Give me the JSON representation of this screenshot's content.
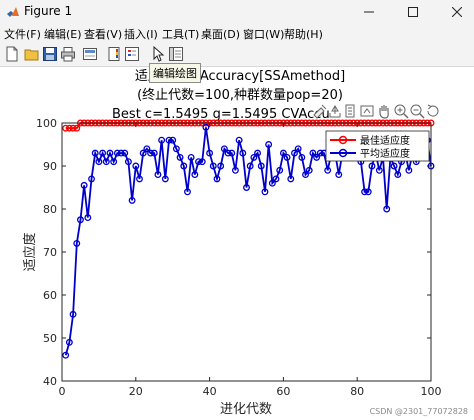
{
  "window": {
    "title": "Figure 1"
  },
  "menu": [
    "文件(F)",
    "编辑(E)",
    "查看(V)",
    "插入(I)",
    "工具(T)",
    "桌面(D)",
    "窗口(W)",
    "帮助(H)"
  ],
  "toolbar": {
    "tooltip": "编辑绘图"
  },
  "watermark": "CSDN @2301_77072828",
  "chart_data": {
    "type": "line",
    "title_lines": [
      "适应度曲线Accuracy[SSAmethod]",
      "(终止代数=100,种群数量pop=20)",
      "Best c=1.5495 g=1.5495 CVAccu"
    ],
    "xlabel": "进化代数",
    "ylabel": "适应度",
    "xlim": [
      0,
      100
    ],
    "ylim": [
      40,
      100
    ],
    "xticks": [
      0,
      20,
      40,
      60,
      80,
      100
    ],
    "yticks": [
      40,
      50,
      60,
      70,
      80,
      90,
      100
    ],
    "legend_position": "top-right",
    "grid": false,
    "series": [
      {
        "name": "最佳适应度",
        "color": "#ff0000",
        "marker": "circle",
        "x": [
          1,
          2,
          3,
          4,
          5,
          6,
          7,
          8,
          9,
          10,
          11,
          12,
          13,
          14,
          15,
          16,
          17,
          18,
          19,
          20,
          21,
          22,
          23,
          24,
          25,
          26,
          27,
          28,
          29,
          30,
          31,
          32,
          33,
          34,
          35,
          36,
          37,
          38,
          39,
          40,
          41,
          42,
          43,
          44,
          45,
          46,
          47,
          48,
          49,
          50,
          51,
          52,
          53,
          54,
          55,
          56,
          57,
          58,
          59,
          60,
          61,
          62,
          63,
          64,
          65,
          66,
          67,
          68,
          69,
          70,
          71,
          72,
          73,
          74,
          75,
          76,
          77,
          78,
          79,
          80,
          81,
          82,
          83,
          84,
          85,
          86,
          87,
          88,
          89,
          90,
          91,
          92,
          93,
          94,
          95,
          96,
          97,
          98,
          99,
          100
        ],
        "values": [
          98.8,
          98.8,
          98.8,
          98.8,
          100,
          100,
          100,
          100,
          100,
          100,
          100,
          100,
          100,
          100,
          100,
          100,
          100,
          100,
          100,
          100,
          100,
          100,
          100,
          100,
          100,
          100,
          100,
          100,
          100,
          100,
          100,
          100,
          100,
          100,
          100,
          100,
          100,
          100,
          100,
          100,
          100,
          100,
          100,
          100,
          100,
          100,
          100,
          100,
          100,
          100,
          100,
          100,
          100,
          100,
          100,
          100,
          100,
          100,
          100,
          100,
          100,
          100,
          100,
          100,
          100,
          100,
          100,
          100,
          100,
          100,
          100,
          100,
          100,
          100,
          100,
          100,
          100,
          100,
          100,
          100,
          100,
          100,
          100,
          100,
          100,
          100,
          100,
          100,
          100,
          100,
          100,
          100,
          100,
          100,
          100,
          100,
          100,
          100,
          100,
          100
        ]
      },
      {
        "name": "平均适应度",
        "color": "#0000cc",
        "marker": "circle",
        "x": [
          1,
          2,
          3,
          4,
          5,
          6,
          7,
          8,
          9,
          10,
          11,
          12,
          13,
          14,
          15,
          16,
          17,
          18,
          19,
          20,
          21,
          22,
          23,
          24,
          25,
          26,
          27,
          28,
          29,
          30,
          31,
          32,
          33,
          34,
          35,
          36,
          37,
          38,
          39,
          40,
          41,
          42,
          43,
          44,
          45,
          46,
          47,
          48,
          49,
          50,
          51,
          52,
          53,
          54,
          55,
          56,
          57,
          58,
          59,
          60,
          61,
          62,
          63,
          64,
          65,
          66,
          67,
          68,
          69,
          70,
          71,
          72,
          73,
          74,
          75,
          76,
          77,
          78,
          79,
          80,
          81,
          82,
          83,
          84,
          85,
          86,
          87,
          88,
          89,
          90,
          91,
          92,
          93,
          94,
          95,
          96,
          97,
          98,
          99,
          100
        ],
        "values": [
          46,
          49,
          55.5,
          72,
          77.5,
          85.5,
          78,
          87,
          93,
          91,
          93,
          91,
          93,
          91,
          93,
          93,
          93,
          91,
          82,
          90,
          87,
          93,
          94,
          93,
          93,
          88,
          96,
          87,
          96,
          96,
          94,
          92,
          90,
          84,
          92,
          88,
          91,
          91,
          99,
          93,
          90,
          87,
          90,
          94,
          93,
          93,
          89,
          96,
          93,
          85,
          90,
          92,
          93,
          90,
          84,
          95,
          86,
          87,
          89,
          93,
          92,
          87,
          93,
          94,
          92,
          88,
          89,
          93,
          92,
          93,
          93,
          89,
          93,
          93,
          88,
          93,
          94,
          95,
          93,
          92,
          91,
          84,
          84,
          90,
          93,
          89,
          92,
          80,
          92,
          90,
          88,
          91,
          93,
          89,
          93,
          91,
          93,
          92,
          96,
          90
        ]
      }
    ]
  }
}
